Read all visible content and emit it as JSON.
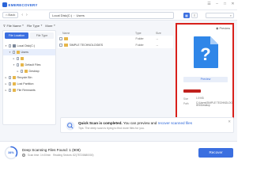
{
  "app": {
    "name": "EMERECOVERY"
  },
  "nav": {
    "back_label": "Back",
    "breadcrumb": [
      "Local Disk(C:)",
      "Users"
    ]
  },
  "filters": {
    "file_name": "File Name",
    "file_type": "File Type",
    "more": "More"
  },
  "sidebar": {
    "tabs": [
      "File Location",
      "File Type"
    ],
    "tree": [
      {
        "label": "Local Disk(C:)",
        "level": 0,
        "kind": "drive",
        "expanded": true
      },
      {
        "label": "Users",
        "level": 1,
        "kind": "folder",
        "expanded": true,
        "selected": true
      },
      {
        "label": "",
        "level": 2,
        "kind": "folder",
        "expanded": false
      },
      {
        "label": "Default Files",
        "level": 2,
        "kind": "folder",
        "expanded": true
      },
      {
        "label": "Desktop",
        "level": 3,
        "kind": "folder",
        "expanded": false
      },
      {
        "label": "Recycle Bin",
        "level": 0,
        "kind": "folder",
        "expanded": false
      },
      {
        "label": "Lost Partition",
        "level": 0,
        "kind": "folder",
        "expanded": false
      },
      {
        "label": "File Remnants",
        "level": 0,
        "kind": "folder",
        "expanded": false
      }
    ]
  },
  "filelist": {
    "headers": {
      "name": "Name",
      "type": "Type",
      "size": "Size"
    },
    "rows": [
      {
        "name": "",
        "type": "Folder",
        "size": "--"
      },
      {
        "name": "SIMPLE TECHNOLOGIES",
        "type": "Folder",
        "size": "--"
      }
    ]
  },
  "preview": {
    "title": "Preview",
    "button": "Preview",
    "meta": [
      {
        "key": "Size",
        "value": "1.9 KB"
      },
      {
        "key": "Path",
        "value": "C:\\Users\\SIMPLE TECHNOLOGIES\\Desktop"
      }
    ],
    "accent": "#d8201b"
  },
  "notice": {
    "bold": "Quick Scan is completed.",
    "normal": " You can preview and ",
    "link": "recover scanned files",
    "tip": "Tips: The deep scan is trying to find more files for you."
  },
  "status": {
    "percent": "34%",
    "progress_fraction": 0.34,
    "title": "Deep Scanning Files Found: 1 (908)",
    "elapsed_label": "Scan time: 1h 00min",
    "reading": "Reading Sectors: 82(7872/8680000)",
    "recover_label": "Recover"
  },
  "colors": {
    "primary": "#3b6fe0",
    "folder": "#e6b64a"
  }
}
